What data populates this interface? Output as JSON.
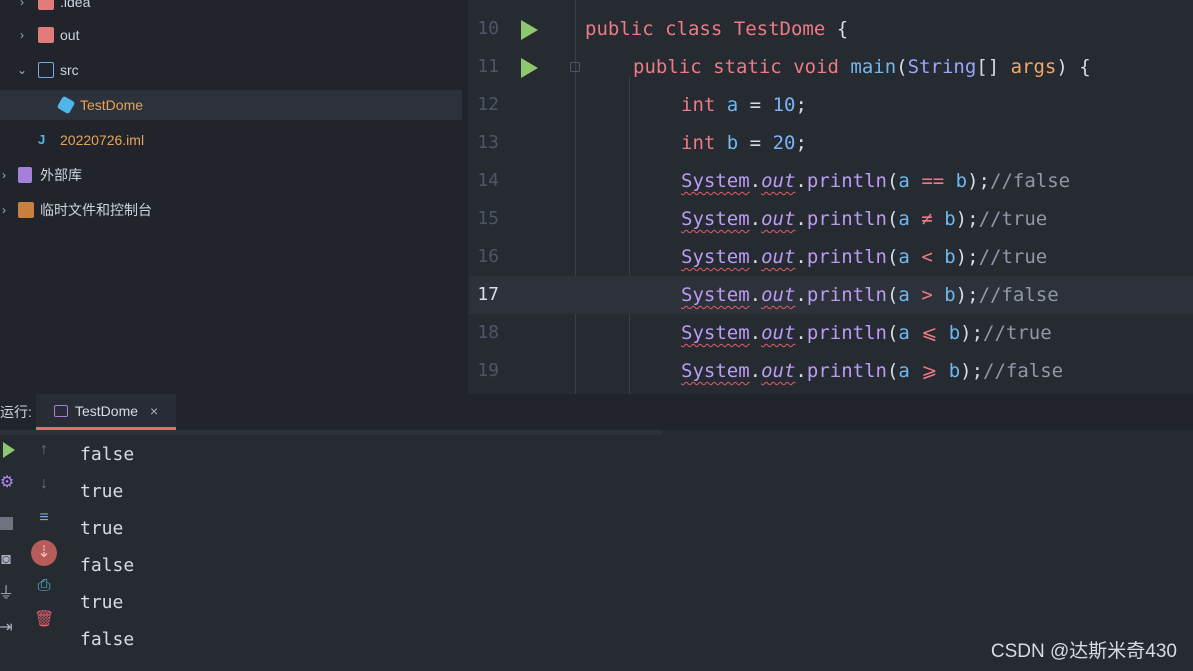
{
  "tree": {
    "items": [
      {
        "label": ".idea",
        "type": "folder",
        "expanded": false
      },
      {
        "label": "out",
        "type": "folder",
        "expanded": false
      },
      {
        "label": "src",
        "type": "source-folder",
        "expanded": true
      },
      {
        "label": "TestDome",
        "type": "class",
        "selected": true
      },
      {
        "label": "20220726.iml",
        "type": "iml-file"
      },
      {
        "label": "外部库",
        "type": "library"
      },
      {
        "label": "临时文件和控制台",
        "type": "scratch"
      }
    ]
  },
  "editor": {
    "current_line": "17",
    "lines": [
      {
        "num": "10"
      },
      {
        "num": "11"
      },
      {
        "num": "12"
      },
      {
        "num": "13"
      },
      {
        "num": "14"
      },
      {
        "num": "15"
      },
      {
        "num": "16"
      },
      {
        "num": "17"
      },
      {
        "num": "18"
      },
      {
        "num": "19"
      }
    ],
    "code": {
      "l10": {
        "kw1": "public",
        "kw2": "class",
        "name": "TestDome",
        "brace": " {"
      },
      "l11": {
        "kw1": "public",
        "kw2": "static",
        "kw3": "void",
        "fn": "main",
        "type": "String",
        "brackets": "[]",
        "param": "args",
        "tail": ") {"
      },
      "l12": {
        "kw": "int",
        "var": "a",
        "eq": " = ",
        "num": "10",
        "semi": ";"
      },
      "l13": {
        "kw": "int",
        "var": "b",
        "eq": " = ",
        "num": "20",
        "semi": ";"
      },
      "print_sys": "System",
      "print_out": "out",
      "print_meth": "println",
      "l14": {
        "op": "==",
        "comment": "//false"
      },
      "l15": {
        "op": "≠",
        "comment": "//true"
      },
      "l16": {
        "op": "<",
        "comment": "//true"
      },
      "l17": {
        "op": ">",
        "comment": "//false"
      },
      "l18": {
        "op": "⩽",
        "comment": "//true"
      },
      "l19": {
        "op": "⩾",
        "comment": "//false"
      }
    }
  },
  "run": {
    "label": "运行:",
    "tab_label": "TestDome",
    "tab_close": "×",
    "output": [
      "false",
      "true",
      "true",
      "false",
      "true",
      "false"
    ]
  },
  "watermark": "CSDN @达斯米奇430",
  "colors": {
    "background": "#262a31",
    "tree_bg": "#21252b",
    "keyword": "#ee7a86",
    "run_green": "#8ec76f",
    "tab_accent": "#e26f6f"
  }
}
